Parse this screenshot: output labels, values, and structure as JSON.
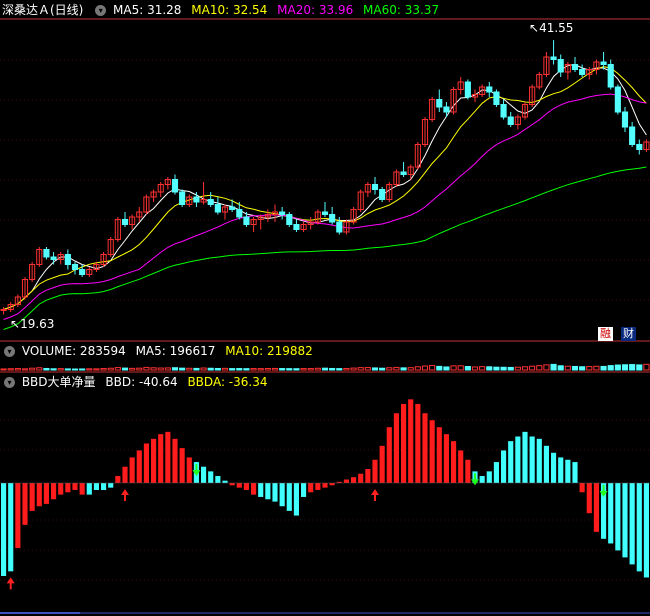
{
  "header": {
    "title": "深桑达Ａ(日线)",
    "ma5": "MA5: 31.28",
    "ma10": "MA10: 32.54",
    "ma20": "MA20: 33.96",
    "ma60": "MA60: 33.37",
    "colors": {
      "ma5": "#ffffff",
      "ma10": "#ffff00",
      "ma20": "#ff00ff",
      "ma60": "#00ff00"
    }
  },
  "price_panel": {
    "high_label": "41.55",
    "low_label": "19.63",
    "btn_left": "融",
    "btn_right": "财"
  },
  "volume_panel": {
    "title": "VOLUME: 283594",
    "ma5": "MA5: 196617",
    "ma10": "MA10: 219882"
  },
  "bbd_panel": {
    "title": "BBD大单净量",
    "bbd": "BBD: -40.64",
    "bbda": "BBDA: -36.34"
  },
  "chart_data": [
    {
      "type": "candlestick",
      "name": "price",
      "high_marker": 41.55,
      "low_marker": 19.63,
      "ylim": [
        19,
        43
      ],
      "ohlc": [
        [
          20.0,
          20.2,
          19.6,
          20.0
        ],
        [
          20.0,
          20.6,
          19.8,
          20.4
        ],
        [
          20.4,
          21.2,
          20.2,
          21.0
        ],
        [
          21.0,
          22.6,
          20.8,
          22.4
        ],
        [
          22.4,
          23.8,
          22.2,
          23.6
        ],
        [
          23.6,
          25.0,
          23.4,
          24.8
        ],
        [
          24.8,
          25.0,
          24.0,
          24.2
        ],
        [
          24.2,
          24.6,
          23.6,
          24.0
        ],
        [
          24.0,
          24.6,
          23.6,
          24.4
        ],
        [
          24.4,
          24.8,
          23.2,
          23.6
        ],
        [
          23.6,
          23.8,
          22.8,
          23.2
        ],
        [
          23.2,
          23.6,
          22.6,
          22.8
        ],
        [
          22.8,
          23.4,
          22.6,
          23.2
        ],
        [
          23.2,
          23.8,
          23.0,
          23.6
        ],
        [
          23.6,
          24.6,
          23.4,
          24.4
        ],
        [
          24.4,
          25.8,
          24.2,
          25.6
        ],
        [
          25.6,
          27.4,
          25.4,
          27.2
        ],
        [
          27.2,
          27.8,
          26.6,
          26.8
        ],
        [
          26.8,
          27.6,
          26.4,
          27.4
        ],
        [
          27.4,
          28.2,
          27.0,
          27.8
        ],
        [
          27.8,
          29.2,
          27.6,
          29.0
        ],
        [
          29.0,
          29.6,
          28.6,
          29.4
        ],
        [
          29.4,
          30.2,
          29.0,
          30.0
        ],
        [
          30.0,
          30.6,
          29.6,
          30.4
        ],
        [
          30.4,
          30.8,
          29.2,
          29.4
        ],
        [
          29.4,
          29.6,
          28.2,
          28.4
        ],
        [
          28.4,
          29.2,
          28.2,
          29.0
        ],
        [
          29.0,
          29.4,
          28.2,
          28.6
        ],
        [
          28.6,
          30.2,
          28.4,
          28.8
        ],
        [
          28.8,
          29.4,
          28.2,
          28.4
        ],
        [
          28.4,
          29.0,
          27.6,
          27.8
        ],
        [
          27.8,
          28.4,
          27.2,
          28.2
        ],
        [
          28.2,
          28.8,
          27.8,
          28.0
        ],
        [
          28.0,
          28.6,
          27.2,
          27.4
        ],
        [
          27.4,
          27.8,
          26.6,
          26.8
        ],
        [
          26.8,
          27.4,
          26.2,
          27.2
        ],
        [
          27.2,
          27.6,
          26.4,
          27.4
        ],
        [
          27.4,
          28.0,
          27.0,
          27.6
        ],
        [
          27.6,
          28.4,
          27.0,
          27.8
        ],
        [
          27.8,
          28.2,
          27.2,
          27.6
        ],
        [
          27.6,
          27.8,
          26.6,
          26.8
        ],
        [
          26.8,
          27.2,
          26.2,
          26.4
        ],
        [
          26.4,
          27.0,
          26.2,
          26.8
        ],
        [
          26.8,
          27.4,
          26.4,
          27.0
        ],
        [
          27.0,
          28.0,
          26.8,
          27.8
        ],
        [
          27.8,
          28.6,
          27.4,
          27.6
        ],
        [
          27.6,
          28.2,
          26.8,
          27.0
        ],
        [
          27.0,
          27.4,
          26.0,
          26.2
        ],
        [
          26.2,
          27.2,
          26.0,
          27.0
        ],
        [
          27.0,
          28.2,
          26.8,
          28.0
        ],
        [
          28.0,
          29.6,
          27.8,
          29.4
        ],
        [
          29.4,
          30.2,
          29.0,
          30.0
        ],
        [
          30.0,
          30.6,
          29.2,
          29.6
        ],
        [
          29.6,
          29.8,
          28.6,
          28.8
        ],
        [
          28.8,
          30.2,
          28.6,
          30.0
        ],
        [
          30.0,
          31.2,
          29.8,
          31.0
        ],
        [
          31.0,
          31.8,
          30.6,
          30.8
        ],
        [
          30.8,
          31.6,
          30.4,
          31.4
        ],
        [
          31.4,
          33.4,
          31.2,
          33.2
        ],
        [
          33.2,
          35.4,
          33.0,
          35.2
        ],
        [
          35.2,
          37.0,
          35.0,
          36.8
        ],
        [
          36.8,
          37.6,
          35.8,
          36.2
        ],
        [
          36.2,
          36.6,
          35.4,
          35.8
        ],
        [
          35.8,
          37.8,
          35.6,
          37.6
        ],
        [
          37.6,
          38.6,
          37.2,
          38.2
        ],
        [
          38.2,
          38.4,
          36.8,
          37.0
        ],
        [
          37.0,
          37.6,
          36.6,
          37.2
        ],
        [
          37.2,
          38.0,
          37.0,
          37.8
        ],
        [
          37.8,
          38.2,
          37.0,
          37.4
        ],
        [
          37.4,
          37.6,
          36.2,
          36.4
        ],
        [
          36.4,
          36.8,
          35.2,
          35.4
        ],
        [
          35.4,
          35.8,
          34.6,
          34.8
        ],
        [
          34.8,
          35.6,
          34.4,
          35.4
        ],
        [
          35.4,
          36.6,
          35.2,
          36.4
        ],
        [
          36.4,
          38.0,
          36.2,
          37.8
        ],
        [
          37.8,
          39.0,
          37.6,
          38.8
        ],
        [
          38.8,
          40.6,
          38.6,
          40.2
        ],
        [
          40.2,
          41.55,
          39.6,
          40.0
        ],
        [
          40.0,
          40.4,
          38.6,
          39.0
        ],
        [
          39.0,
          39.8,
          38.4,
          39.6
        ],
        [
          39.6,
          40.2,
          39.0,
          39.2
        ],
        [
          39.2,
          39.6,
          38.6,
          38.8
        ],
        [
          38.8,
          39.4,
          38.4,
          39.2
        ],
        [
          39.2,
          40.0,
          38.8,
          39.8
        ],
        [
          39.8,
          40.6,
          39.2,
          39.6
        ],
        [
          39.6,
          40.0,
          37.6,
          37.8
        ],
        [
          37.8,
          38.0,
          35.6,
          35.8
        ],
        [
          35.8,
          36.2,
          34.2,
          34.6
        ],
        [
          34.6,
          35.0,
          33.0,
          33.2
        ],
        [
          33.2,
          33.6,
          32.4,
          32.8
        ],
        [
          32.8,
          33.6,
          32.6,
          33.4
        ]
      ]
    },
    {
      "type": "bar",
      "name": "VOLUME",
      "ylim": [
        0,
        600000
      ],
      "values": [
        52000,
        64000,
        71000,
        58000,
        90000,
        112000,
        76000,
        61000,
        68000,
        55000,
        49000,
        52000,
        60000,
        58000,
        72000,
        88000,
        120000,
        96000,
        82000,
        91000,
        130000,
        110000,
        98000,
        104000,
        115000,
        92000,
        86000,
        80000,
        99000,
        87000,
        76000,
        82000,
        70000,
        73000,
        66000,
        71000,
        69000,
        75000,
        78000,
        73000,
        68000,
        64000,
        70000,
        72000,
        86000,
        91000,
        77000,
        69000,
        74000,
        96000,
        118000,
        122000,
        104000,
        89000,
        112000,
        130000,
        108000,
        116000,
        162000,
        198000,
        226000,
        181000,
        152000,
        207000,
        211000,
        176000,
        150000,
        168000,
        160000,
        141000,
        136000,
        128000,
        139000,
        160000,
        190000,
        214000,
        256000,
        281000,
        210000,
        188000,
        176000,
        162000,
        171000,
        186000,
        179000,
        220000,
        248000,
        262000,
        271000,
        254000,
        283594
      ]
    },
    {
      "type": "bar",
      "name": "BBD",
      "ylim": [
        -45,
        40
      ],
      "values": [
        -40.0,
        -38.0,
        -28.0,
        -18.0,
        -12.0,
        -10.0,
        -9.0,
        -7.0,
        -5.0,
        -4.0,
        -3.0,
        -5.0,
        -5.0,
        -3.0,
        -3.0,
        -2.0,
        3.0,
        7.0,
        11.0,
        14.0,
        17.0,
        19.0,
        21.0,
        22.0,
        19.0,
        15.0,
        11.0,
        9.0,
        7.0,
        5.0,
        3.0,
        1.0,
        -1.0,
        -2.0,
        -3.0,
        -5.0,
        -6.0,
        -7.0,
        -8.0,
        -10.0,
        -12.0,
        -14.0,
        -6.0,
        -4.0,
        -3.0,
        -2.0,
        -1.0,
        0.5,
        1.5,
        2.5,
        4.0,
        6.0,
        10.0,
        16.0,
        24.0,
        30.0,
        34.0,
        36.0,
        34.0,
        30.0,
        27.0,
        24.0,
        21.0,
        18.0,
        14.0,
        10.0,
        5.0,
        3.0,
        5.0,
        9.0,
        14.0,
        18.0,
        20.0,
        22.0,
        20.0,
        19.0,
        16.0,
        13.0,
        11.0,
        10.0,
        9.0,
        -4.0,
        -13.0,
        -21.0,
        -24.0,
        -26.0,
        -29.0,
        -32.0,
        -35.0,
        -38.0,
        -40.64
      ],
      "signals": [
        {
          "index": 1,
          "type": "up"
        },
        {
          "index": 17,
          "type": "up"
        },
        {
          "index": 27,
          "type": "down"
        },
        {
          "index": 52,
          "type": "up"
        },
        {
          "index": 66,
          "type": "down"
        },
        {
          "index": 84,
          "type": "down"
        }
      ]
    }
  ]
}
